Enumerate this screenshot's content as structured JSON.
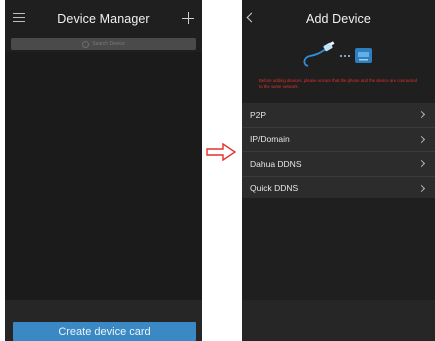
{
  "left_screen": {
    "title": "Device Manager",
    "search_placeholder": "Search Device",
    "create_button_label": "Create device card",
    "icons": {
      "menu": "hamburger-icon",
      "add": "plus-icon",
      "search": "search-icon"
    }
  },
  "right_screen": {
    "title": "Add Device",
    "warning_text": "Before adding devices, please ensure that the phone and the device are connected to the same network.",
    "menu_items": [
      {
        "label": "P2P"
      },
      {
        "label": "IP/Domain"
      },
      {
        "label": "Dahua DDNS"
      },
      {
        "label": "Quick DDNS"
      }
    ],
    "icons": {
      "back": "back-arrow-icon",
      "chevron": "chevron-right-icon",
      "illustration": "network-cable-device-icon"
    }
  },
  "colors": {
    "screen_bg": "#1f1f1f",
    "button_blue": "#3a89c4",
    "warning_red": "#e0322d",
    "arrow_red": "#e0322d",
    "row_bg": "#2c2c2c"
  }
}
